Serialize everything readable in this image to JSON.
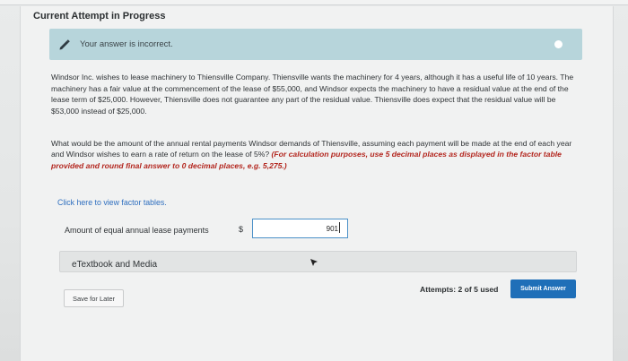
{
  "header": {
    "title": "Current Attempt in Progress"
  },
  "alert": {
    "message": "Your answer is incorrect."
  },
  "problem": {
    "text": "Windsor Inc. wishes to lease machinery to Thiensville Company. Thiensville wants the machinery for 4 years, although it has a useful life of 10 years. The machinery has a fair value at the commencement of the lease of $55,000, and Windsor expects the machinery to have a residual value at the end of the lease term of $25,000. However, Thiensville does not guarantee any part of the residual value. Thiensville does expect that the residual value will be $53,000 instead of $25,000."
  },
  "question": {
    "text": "What would be the amount of the annual rental payments Windsor demands of Thiensville, assuming each payment will be made at the end of each year and Windsor wishes to earn a rate of return on the lease of 5%? ",
    "note": "(For calculation purposes, use 5 decimal places as displayed in the factor table provided and round final answer to 0 decimal places, e.g. 5,275.)"
  },
  "links": {
    "factor_tables": "Click here to view factor tables."
  },
  "answer": {
    "label": "Amount of equal annual lease payments",
    "currency": "$",
    "value": "901"
  },
  "ebook": {
    "label": "eTextbook and Media"
  },
  "footer": {
    "save_label": "Save for Later",
    "attempts": "Attempts: 2 of 5 used",
    "submit_label": "Submit Answer"
  },
  "colors": {
    "alert_bg": "#b7d5db",
    "link": "#2f6fbf",
    "note": "#b3261e",
    "submit_bg": "#1f6fb8"
  }
}
